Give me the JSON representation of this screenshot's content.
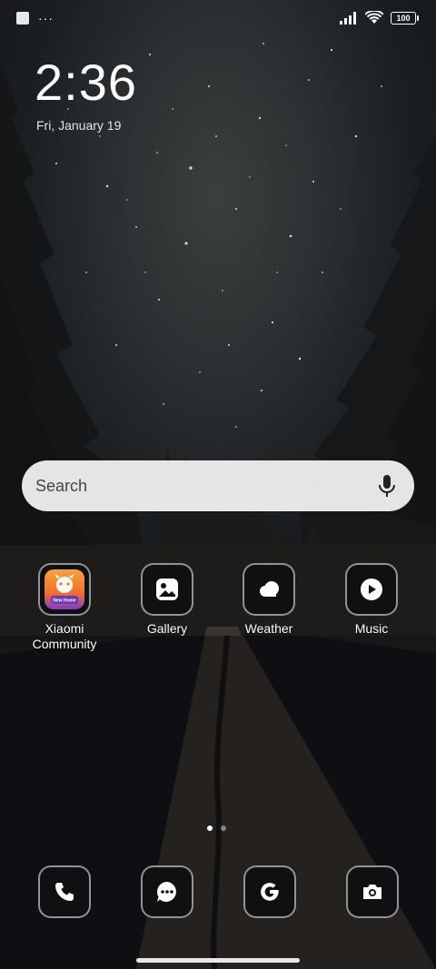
{
  "status_bar": {
    "notification_dots": "···",
    "battery_level": "100"
  },
  "lock_info": {
    "time": "2:36",
    "date": "Fri, January 19"
  },
  "search": {
    "label": "Search"
  },
  "apps": [
    {
      "label": "Xiaomi Community",
      "icon": "xiaomi-community-icon"
    },
    {
      "label": "Gallery",
      "icon": "gallery-icon"
    },
    {
      "label": "Weather",
      "icon": "weather-icon"
    },
    {
      "label": "Music",
      "icon": "music-icon"
    }
  ],
  "xiaomi_community_badge": "New Home",
  "page_indicator": {
    "total": 2,
    "current": 1
  },
  "dock": [
    {
      "icon": "phone-icon"
    },
    {
      "icon": "messages-icon"
    },
    {
      "icon": "google-icon"
    },
    {
      "icon": "camera-icon"
    }
  ],
  "colors": {
    "accent": "#f58a2a",
    "search_bg": "#f5f5f5"
  }
}
